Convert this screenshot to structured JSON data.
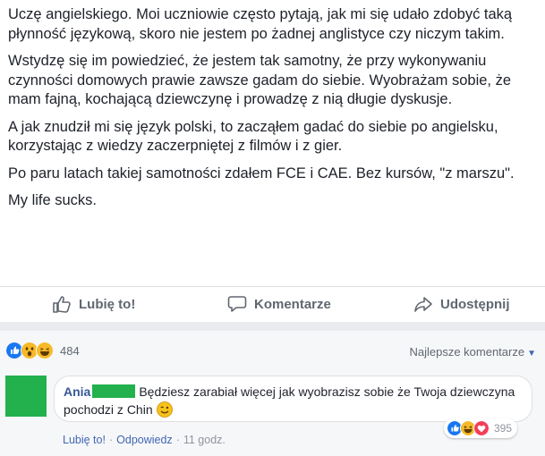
{
  "post": {
    "paragraphs": [
      "Uczę angielskiego. Moi uczniowie często pytają, jak mi się udało zdobyć taką płynność językową, skoro nie jestem po żadnej anglistyce czy niczym takim.",
      "Wstydzę się im powiedzieć, że jestem tak samotny, że przy wykonywaniu czynności domowych prawie zawsze gadam do siebie. Wyobrażam sobie, że mam fajną, kochającą dziewczynę i prowadzę z nią długie dyskusje.",
      "A jak znudził mi się język polski, to zacząłem gadać do siebie po angielsku, korzystając z wiedzy zaczerpniętej z filmów i z gier.",
      "Po paru latach takiej samotności zdałem FCE i CAE. Bez kursów, \"z marszu\".",
      "My life sucks."
    ]
  },
  "actions": {
    "like_label": "Lubię to!",
    "comment_label": "Komentarze",
    "share_label": "Udostępnij"
  },
  "reactions": {
    "count": "484",
    "icons": [
      "like-icon",
      "wow-icon",
      "haha-icon"
    ],
    "sort_label": "Najlepsze komentarze"
  },
  "comment": {
    "author": "Ania",
    "text": "Będziesz zarabiał więcej jak wyobrazisz sobie że Twoja dziewczyna pochodzi z Chin",
    "like_label": "Lubię to!",
    "reply_label": "Odpowiedz",
    "time": "11 godz.",
    "separator": "·",
    "reaction_count": "395",
    "reaction_icons": [
      "like-icon",
      "haha-icon",
      "love-icon"
    ]
  },
  "colors": {
    "link": "#385898",
    "muted": "#606770",
    "censor": "#22b14c",
    "like_blue": "#1877f2",
    "love_red": "#f33e58",
    "haha_yellow": "#f7b928"
  }
}
